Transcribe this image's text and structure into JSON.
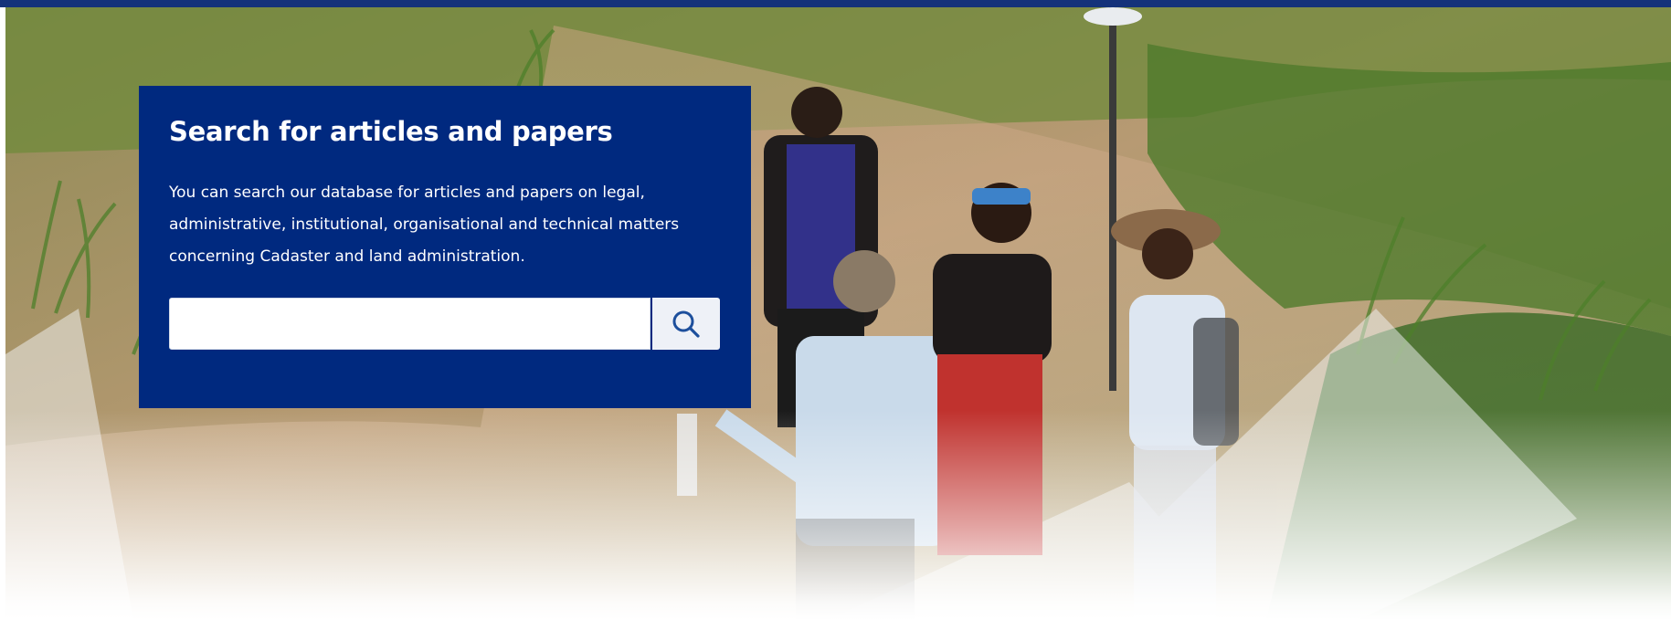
{
  "hero": {
    "photo_description_icon": "field-survey-photo",
    "search": {
      "title": "Search for articles and papers",
      "description_lines": [
        "You can search our database for articles and papers on legal,",
        "administrative, institutional, organisational and technical matters",
        "concerning Cadaster and land administration."
      ],
      "input_value": "",
      "input_placeholder": "",
      "button_icon": "search-icon"
    }
  },
  "colors": {
    "panel_background": "#00297f",
    "top_stripe": "#14327a",
    "search_button_background": "#eef1f7",
    "icon_color": "#1d4f9c"
  }
}
